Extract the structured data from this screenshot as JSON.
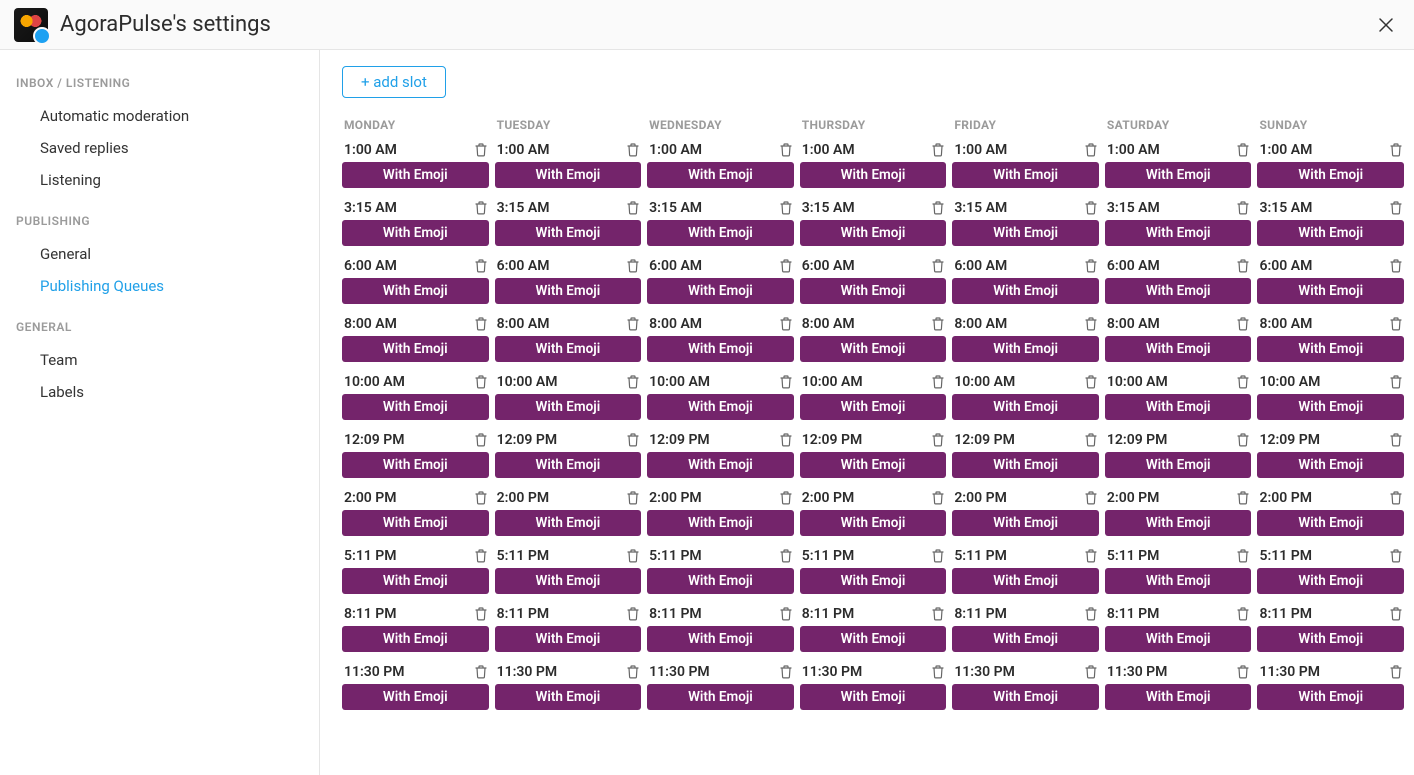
{
  "header": {
    "title": "AgoraPulse's settings"
  },
  "sidebar": {
    "sections": [
      {
        "heading": "INBOX / LISTENING",
        "items": [
          {
            "label": "Automatic moderation",
            "active": false
          },
          {
            "label": "Saved replies",
            "active": false
          },
          {
            "label": "Listening",
            "active": false
          }
        ]
      },
      {
        "heading": "PUBLISHING",
        "items": [
          {
            "label": "General",
            "active": false
          },
          {
            "label": "Publishing Queues",
            "active": true
          }
        ]
      },
      {
        "heading": "GENERAL",
        "items": [
          {
            "label": "Team",
            "active": false
          },
          {
            "label": "Labels",
            "active": false
          }
        ]
      }
    ]
  },
  "main": {
    "add_slot_label": "+ add slot",
    "days": [
      "MONDAY",
      "TUESDAY",
      "WEDNESDAY",
      "THURSDAY",
      "FRIDAY",
      "SATURDAY",
      "SUNDAY"
    ],
    "times": [
      "1:00 AM",
      "3:15 AM",
      "6:00 AM",
      "8:00 AM",
      "10:00 AM",
      "12:09 PM",
      "2:00 PM",
      "5:11 PM",
      "8:11 PM",
      "11:30 PM"
    ],
    "tag_label": "With Emoji",
    "tag_color": "#74246b"
  }
}
